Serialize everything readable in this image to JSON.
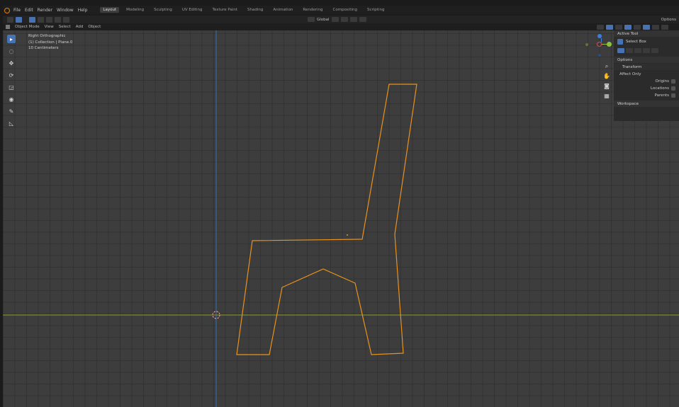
{
  "menubar": {
    "menus": [
      "File",
      "Edit",
      "Render",
      "Window",
      "Help"
    ],
    "workspaces": [
      "Layout",
      "Modeling",
      "Sculpting",
      "UV Editing",
      "Texture Paint",
      "Shading",
      "Animation",
      "Rendering",
      "Compositing",
      "Scripting"
    ],
    "active_workspace": "Layout"
  },
  "tool_header": {
    "orientation": "Global",
    "options_label": "Options"
  },
  "viewport_header": {
    "mode": "Object Mode",
    "menus": [
      "View",
      "Select",
      "Add",
      "Object"
    ]
  },
  "viewport": {
    "view_name": "Right Orthographic",
    "collection": "(1) Collection | Plane.0",
    "scale": "10 Centimeters"
  },
  "sidebar": {
    "active_tool_header": "Active Tool",
    "tool_name": "Select Box",
    "options_header": "Options",
    "transform_header": "Transform",
    "affect_only": "Affect Only",
    "origins": "Origins",
    "locations": "Locations",
    "parents": "Parents",
    "workspace_header": "Workspace"
  },
  "colors": {
    "accent": "#4772b3",
    "selection_outline": "#e8921c",
    "axis_y": "#8aa020",
    "axis_z": "#2f6fb8",
    "gizmo_x": "#e0485a",
    "gizmo_y": "#8bc43a",
    "gizmo_z": "#3a80d8"
  },
  "icons": [
    "blender-logo-icon",
    "select-box-icon",
    "cursor-icon",
    "move-icon",
    "rotate-icon",
    "scale-icon",
    "transform-icon",
    "annotate-icon",
    "measure-icon",
    "zoom-icon",
    "pan-icon",
    "camera-icon",
    "grid-icon"
  ]
}
